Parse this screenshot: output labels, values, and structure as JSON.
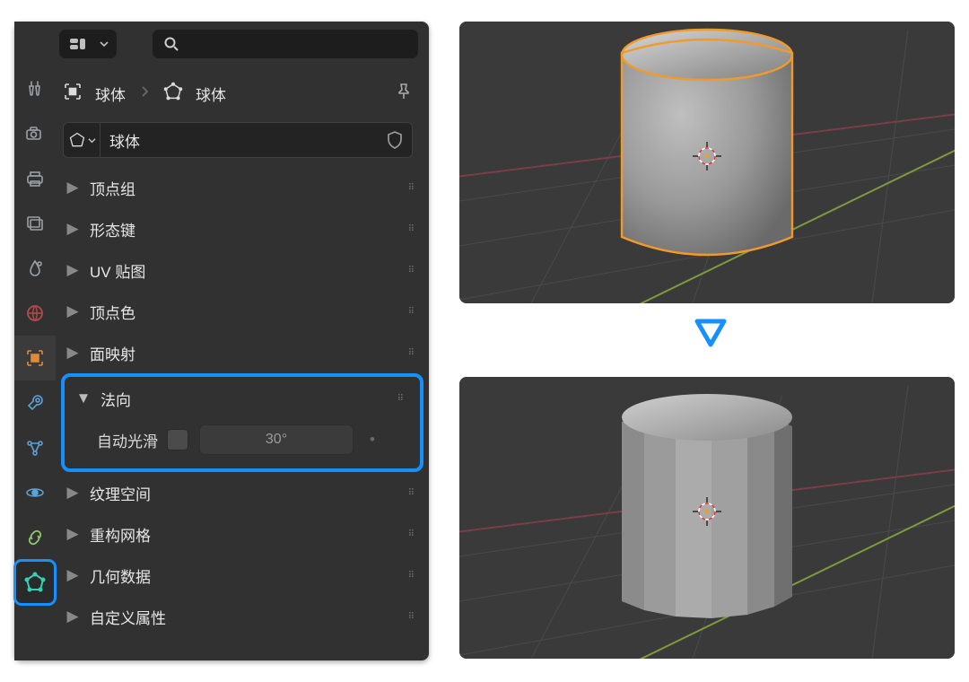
{
  "header": {
    "search_placeholder": ""
  },
  "breadcrumb": {
    "obj_label": "球体",
    "data_label": "球体"
  },
  "name_field": {
    "value": "球体"
  },
  "tabs": [
    {
      "id": "tool",
      "name": "tool-icon"
    },
    {
      "id": "render",
      "name": "camera-icon"
    },
    {
      "id": "output",
      "name": "printer-icon"
    },
    {
      "id": "viewlayer",
      "name": "image-icon"
    },
    {
      "id": "scene",
      "name": "droplet-icon"
    },
    {
      "id": "world",
      "name": "globe-icon"
    },
    {
      "id": "object",
      "name": "square-icon",
      "active": true
    },
    {
      "id": "modifiers",
      "name": "wrench-icon"
    },
    {
      "id": "particles",
      "name": "nodes-icon"
    },
    {
      "id": "physics",
      "name": "orbit-icon"
    },
    {
      "id": "constraint",
      "name": "link-icon"
    },
    {
      "id": "mesh",
      "name": "mesh-icon",
      "highlight": true
    }
  ],
  "sections": [
    {
      "id": "vertex_groups",
      "label": "顶点组",
      "collapsed": true
    },
    {
      "id": "shape_keys",
      "label": "形态键",
      "collapsed": true
    },
    {
      "id": "uv_maps",
      "label": "UV 贴图",
      "collapsed": true
    },
    {
      "id": "vertex_colors",
      "label": "顶点色",
      "collapsed": true
    },
    {
      "id": "face_maps",
      "label": "面映射",
      "collapsed": true
    }
  ],
  "normals": {
    "label": "法向",
    "auto_smooth_label": "自动光滑",
    "auto_smooth_checked": false,
    "auto_smooth_angle": "30°"
  },
  "sections_after": [
    {
      "id": "texture_space",
      "label": "纹理空间",
      "collapsed": true
    },
    {
      "id": "remesh",
      "label": "重构网格",
      "collapsed": true
    },
    {
      "id": "geometry_data",
      "label": "几何数据",
      "collapsed": true
    },
    {
      "id": "custom_props",
      "label": "自定义属性",
      "collapsed": true
    }
  ],
  "viewport": {
    "object_selected": true
  }
}
